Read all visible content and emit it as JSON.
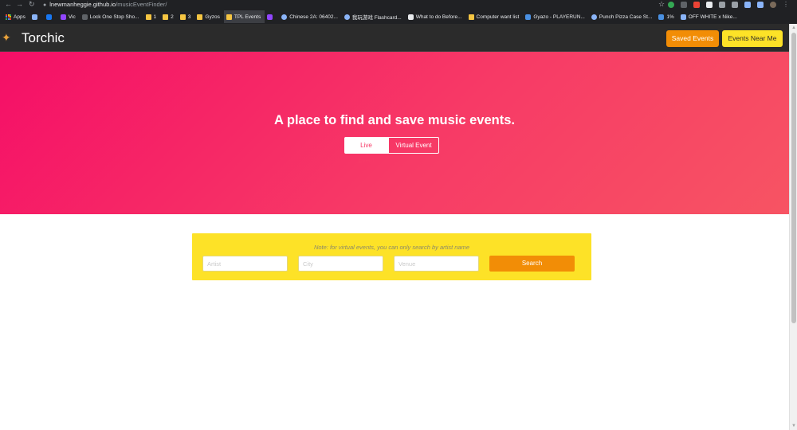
{
  "browser": {
    "url_host": "lnewmanheggie.github.io",
    "url_path": "/musicEventFinder/",
    "bookmarks": [
      {
        "label": "Apps",
        "icon": "apps-grid-icon",
        "color": "#ea4335"
      },
      {
        "label": "",
        "icon": "feather-icon",
        "color": "#8ab4f8"
      },
      {
        "label": "",
        "icon": "facebook-icon",
        "color": "#1877f2"
      },
      {
        "label": "Vic",
        "icon": "twitch-icon",
        "color": "#9146ff"
      },
      {
        "label": "Lock One Stop Sho...",
        "icon": "lock-shop-icon",
        "color": "#5f6368"
      },
      {
        "label": "1",
        "icon": "folder-icon",
        "color": "#f5c542"
      },
      {
        "label": "2",
        "icon": "folder-icon",
        "color": "#f5c542"
      },
      {
        "label": "3",
        "icon": "folder-icon",
        "color": "#f5c542"
      },
      {
        "label": "Gyzos",
        "icon": "folder-icon",
        "color": "#f5c542"
      },
      {
        "label": "TPL Events",
        "icon": "folder-icon",
        "color": "#f5c542"
      },
      {
        "label": "",
        "icon": "twitch-icon",
        "color": "#9146ff"
      },
      {
        "label": "Chinese 2A: 06402...",
        "icon": "s-circle-icon",
        "color": "#8ab4f8"
      },
      {
        "label": "我玩游戏 Flashcard...",
        "icon": "q-circle-icon",
        "color": "#8ab4f8"
      },
      {
        "label": "What to do Before...",
        "icon": "page-icon",
        "color": "#e8eaed"
      },
      {
        "label": "Computer want list",
        "icon": "folder-icon",
        "color": "#f5c542"
      },
      {
        "label": "Gyazo - PLAYERUN...",
        "icon": "gyazo-icon",
        "color": "#4a90e2"
      },
      {
        "label": "Punch Pizza Case St...",
        "icon": "globe-icon",
        "color": "#8ab4f8"
      },
      {
        "label": "1%",
        "icon": "gyazo-icon",
        "color": "#4a90e2"
      },
      {
        "label": "OFF WHITE x Nike...",
        "icon": "image-icon",
        "color": "#8ab4f8"
      }
    ]
  },
  "navbar": {
    "brand": "Torchic",
    "saved_events": "Saved Events",
    "events_near_me": "Events Near Me"
  },
  "hero": {
    "title": "A place to find and save music events.",
    "live_event": "Live Event",
    "virtual_event": "Virtual Event"
  },
  "search": {
    "note": "Note: for virtual events, you can only search by artist name",
    "artist_placeholder": "Artist",
    "city_placeholder": "City",
    "venue_placeholder": "Venue",
    "button": "Search"
  },
  "colors": {
    "navbar": "#2b2b2b",
    "hero_start": "#f50e67",
    "hero_end": "#f75463",
    "orange": "#f28d06",
    "yellow": "#fde227"
  }
}
